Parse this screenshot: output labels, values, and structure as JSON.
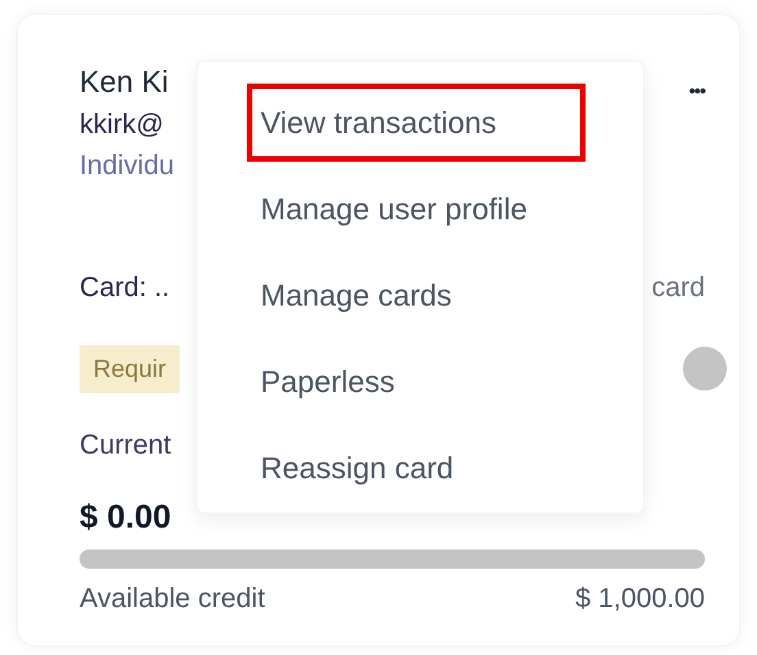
{
  "card": {
    "name": "Ken Ki",
    "email": "kkirk@",
    "role": "Individu",
    "card_label": "Card: ..",
    "card_link": "card",
    "badge": "Requir",
    "current_label": "Current",
    "balance": "$ 0.00",
    "credit": {
      "level": 0
    },
    "available_label": "Available credit",
    "available_value": "$ 1,000.00",
    "more": "•••"
  },
  "menu": {
    "items": [
      {
        "label": "View transactions",
        "selected": true
      },
      {
        "label": "Manage user profile",
        "selected": false
      },
      {
        "label": "Manage cards",
        "selected": false
      },
      {
        "label": "Paperless",
        "selected": false
      },
      {
        "label": "Reassign card",
        "selected": false
      }
    ]
  }
}
